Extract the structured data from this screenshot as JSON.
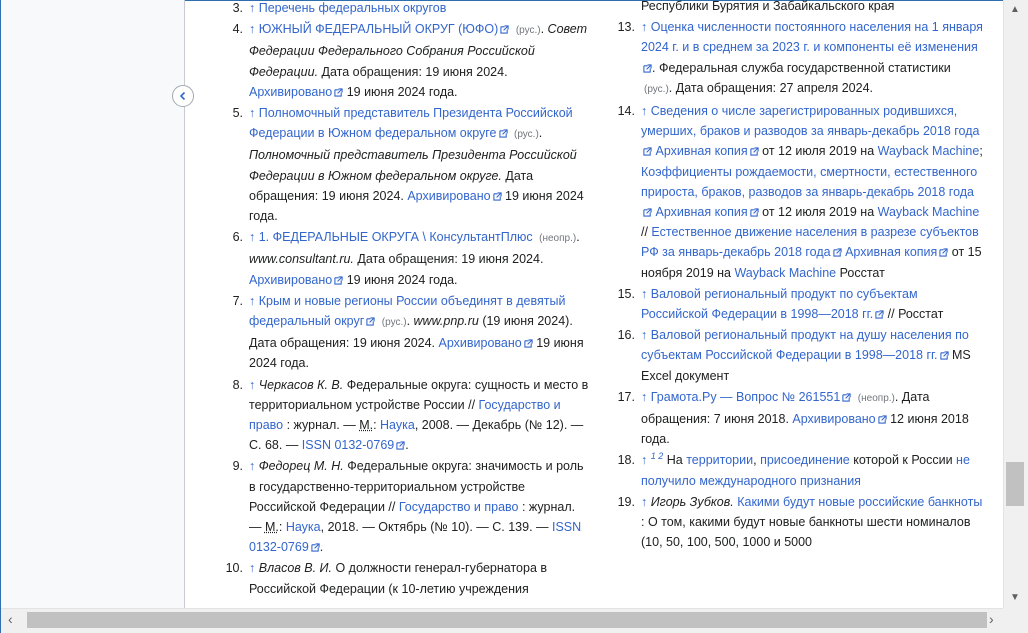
{
  "ext_icon": "external-link-icon",
  "left": {
    "ref3": {
      "num": "3.",
      "up": "↑",
      "t1": "Перечень федеральных округов"
    },
    "ref4": {
      "num": "4.",
      "up": "↑",
      "t1": "ЮЖНЫЙ ФЕДЕРАЛЬНЫЙ ОКРУГ (ЮФО)",
      "lang": "(рус.)",
      "t2": ". ",
      "t3": "Совет Федерации Федерального Собрания Российской Федерации.",
      "t4": " Дата обращения: 19 июня 2024. ",
      "arch": "Архивировано",
      "t5": " 19 июня 2024 года."
    },
    "ref5": {
      "num": "5.",
      "up": "↑",
      "t1": "Полномочный представитель Президента Российской Федерации в Южном федеральном округе",
      "lang": "(рус.)",
      "t2": ". ",
      "t3": "Полномочный представитель Президента Российской Федерации в Южном федеральном округе.",
      "t4": " Дата обращения: 19 июня 2024. ",
      "arch": "Архивировано",
      "t5": " 19 июня 2024 года."
    },
    "ref6": {
      "num": "6.",
      "up": "↑",
      "t1": "1. ФЕДЕРАЛЬНЫЕ ОКРУГА \\ КонсультантПлюс",
      "lang": "(неопр.)",
      "t2": ". ",
      "t3": "www.consultant.ru.",
      "t4": " Дата обращения: 19 июня 2024. ",
      "arch": "Архивировано",
      "t5": " 19 июня 2024 года."
    },
    "ref7": {
      "num": "7.",
      "up": "↑",
      "t1": "Крым и новые регионы России объединят в девятый федеральный округ",
      "lang": "(рус.)",
      "t2": ". ",
      "t3": "www.pnp.ru",
      "t4": " (19 июня 2024). Дата обращения: 19 июня 2024. ",
      "arch": "Архивировано",
      "t5": " 19 июня 2024 года."
    },
    "ref8": {
      "num": "8.",
      "up": "↑",
      "t1": "Черкасов К. В.",
      "t2": " Федеральные округа: сущность и место в территориальном устройстве России // ",
      "j": "Государство и право",
      "t3": " : журнал. — ",
      "m": "М.",
      "t4": ": ",
      "p": "Наука",
      "t5": ", 2008. — Декабрь (№ 12). — С. 68. — ",
      "issn": "ISSN 0132-0769",
      "t6": "."
    },
    "ref9": {
      "num": "9.",
      "up": "↑",
      "t1": "Федорец М. Н.",
      "t2": " Федеральные округа: значимость и роль в государственно-территориальном устройстве Российской Федерации // ",
      "j": "Государство и право",
      "t3": " : журнал. — ",
      "m": "М.",
      "t4": ": ",
      "p": "Наука",
      "t5": ", 2018. — Октябрь (№ 10). — С. 139. — ",
      "issn": "ISSN 0132-0769",
      "t6": "."
    },
    "ref10": {
      "num": "10.",
      "up": "↑",
      "t1": "Власов В. И.",
      "t2": " О должности генерал-губернатора в Российской Федерации (к 10-летию учреждения"
    }
  },
  "right": {
    "top_text": "Республики Бурятия и Забайкальского края",
    "ref13": {
      "num": "13.",
      "up": "↑",
      "t1": "Оценка численности постоянного населения на 1 января 2024 г. и в среднем за 2023 г. и компоненты её изменения",
      "t2": ". Федеральная служба государственной статистики",
      "lang": "(рус.)",
      "t3": ". Дата обращения: 27 апреля 2024."
    },
    "ref14": {
      "num": "14.",
      "up": "↑",
      "t1": "Сведения о числе зарегистрированных родившихся, умерших, браков и разводов за январь-декабрь 2018 года",
      "a1": "Архивная копия",
      "t2": " от 12 июля 2019 на ",
      "wb1": "Wayback Machine",
      "t3": "; ",
      "t4": "Коэффициенты рождаемости, смертности, естественного прироста, браков, разводов за январь-декабрь 2018 года",
      "a2": "Архивная копия",
      "t5": " от 12 июля 2019 на ",
      "wb2": "Wayback Machine",
      "t6": " // ",
      "t7": "Естественное движение населения в разрезе субъектов РФ за январь-декабрь 2018 года",
      "a3": "Архивная копия",
      "t8": " от 15 ноября 2019 на ",
      "wb3": "Wayback Machine",
      "t9": " Росстат"
    },
    "ref15": {
      "num": "15.",
      "up": "↑",
      "t1": "Валовой региональный продукт по субъектам Российской Федерации в 1998—2018 гг.",
      "t2": " // Росстат"
    },
    "ref16": {
      "num": "16.",
      "up": "↑",
      "t1": "Валовой региональный продукт на душу населения по субъектам Российской Федерации в 1998—2018 гг.",
      "t2": " MS Excel документ"
    },
    "ref17": {
      "num": "17.",
      "up": "↑",
      "t1": "Грамота.Ру — Вопрос № 261551",
      "lang": "(неопр.)",
      "t2": ". Дата обращения: 7 июня 2018. ",
      "arch": "Архивировано",
      "t3": " 12 июня 2018 года."
    },
    "ref18": {
      "num": "18.",
      "up": "↑",
      "s1": "1",
      "s2": "2",
      "t1": " На ",
      "l1": "территории",
      "t2": ", ",
      "l2": "присоединение",
      "t3": " которой к России ",
      "l3": "не получило международного признания"
    },
    "ref19": {
      "num": "19.",
      "up": "↑",
      "t1": "Игорь Зубков.",
      "l1": "Какими будут новые российские банкноты",
      "t2": " : О том, какими будут новые банкноты шести номиналов (10, 50, 100, 500, 1000 и 5000"
    }
  },
  "scrollbars": {
    "v_position": 0.79,
    "h_position": 0.02
  }
}
